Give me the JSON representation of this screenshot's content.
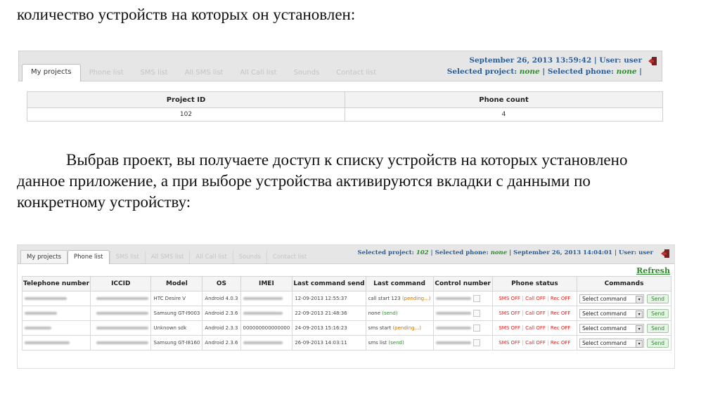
{
  "text": {
    "top_line": "количество устройств на которых он установлен:",
    "middle_paragraph": "Выбрав проект,  вы получаете доступ к списку устройств на которых установлено данное приложение, а при выборе устройства активируются вкладки с данными по конкретному устройству:"
  },
  "screenshot1": {
    "tabs": [
      "My projects",
      "Phone list",
      "SMS list",
      "All SMS list",
      "All Call list",
      "Sounds",
      "Contact list"
    ],
    "datetime": "September 26, 2013 13:59:42",
    "user_label": "User:",
    "user_value": "user",
    "selected_project_label": "Selected project:",
    "selected_project_value": "none",
    "selected_phone_label": "Selected phone:",
    "selected_phone_value": "none",
    "columns": [
      "Project ID",
      "Phone count"
    ],
    "rows": [
      [
        "102",
        "4"
      ]
    ]
  },
  "screenshot2": {
    "tabs": [
      "My projects",
      "Phone list",
      "SMS list",
      "All SMS list",
      "All Call list",
      "Sounds",
      "Contact list"
    ],
    "selected_project_label": "Selected project:",
    "selected_project_value": "102",
    "selected_phone_label": "Selected phone:",
    "selected_phone_value": "none",
    "datetime": "September 26, 2013 14:04:01",
    "user_label": "User:",
    "user_value": "user",
    "refresh_label": "Refresh",
    "columns": [
      "Telephone number",
      "ICCID",
      "Model",
      "OS",
      "IMEI",
      "Last command send",
      "Last command",
      "Control number",
      "Phone status",
      "Commands"
    ],
    "status_buttons": [
      "SMS OFF",
      "Call OFF",
      "Rec OFF"
    ],
    "select_placeholder": "Select command",
    "send_label": "Send",
    "rows": [
      {
        "model": "HTC Desire V",
        "os": "Android 4.0.3",
        "imei": "",
        "last_send": "12-09-2013 12:55:37",
        "cmd": "call start 123",
        "state": "(pending...)",
        "state_type": "pending"
      },
      {
        "model": "Samsung GT-I9003",
        "os": "Android 2.3.6",
        "imei": "",
        "last_send": "22-09-2013 21:48:36",
        "cmd": "none",
        "state": "(send)",
        "state_type": "sent"
      },
      {
        "model": "Unknown sdk",
        "os": "Android 2.3.3",
        "imei": "000000000000000",
        "last_send": "24-09-2013 15:16:23",
        "cmd": "sms start",
        "state": "(pending...)",
        "state_type": "pending"
      },
      {
        "model": "Samsung GT-I8160",
        "os": "Android 2.3.6",
        "imei": "",
        "last_send": "26-09-2013 14:03:11",
        "cmd": "sms list",
        "state": "(send)",
        "state_type": "sent"
      }
    ]
  },
  "colors": {
    "info_blue": "#2b5d95",
    "info_green": "#2e8b2e",
    "status_red": "#dd2222",
    "pending_orange": "#d06f00"
  },
  "icons": [
    "exit-icon",
    "control-number-icon",
    "dropdown-arrow-icon"
  ]
}
